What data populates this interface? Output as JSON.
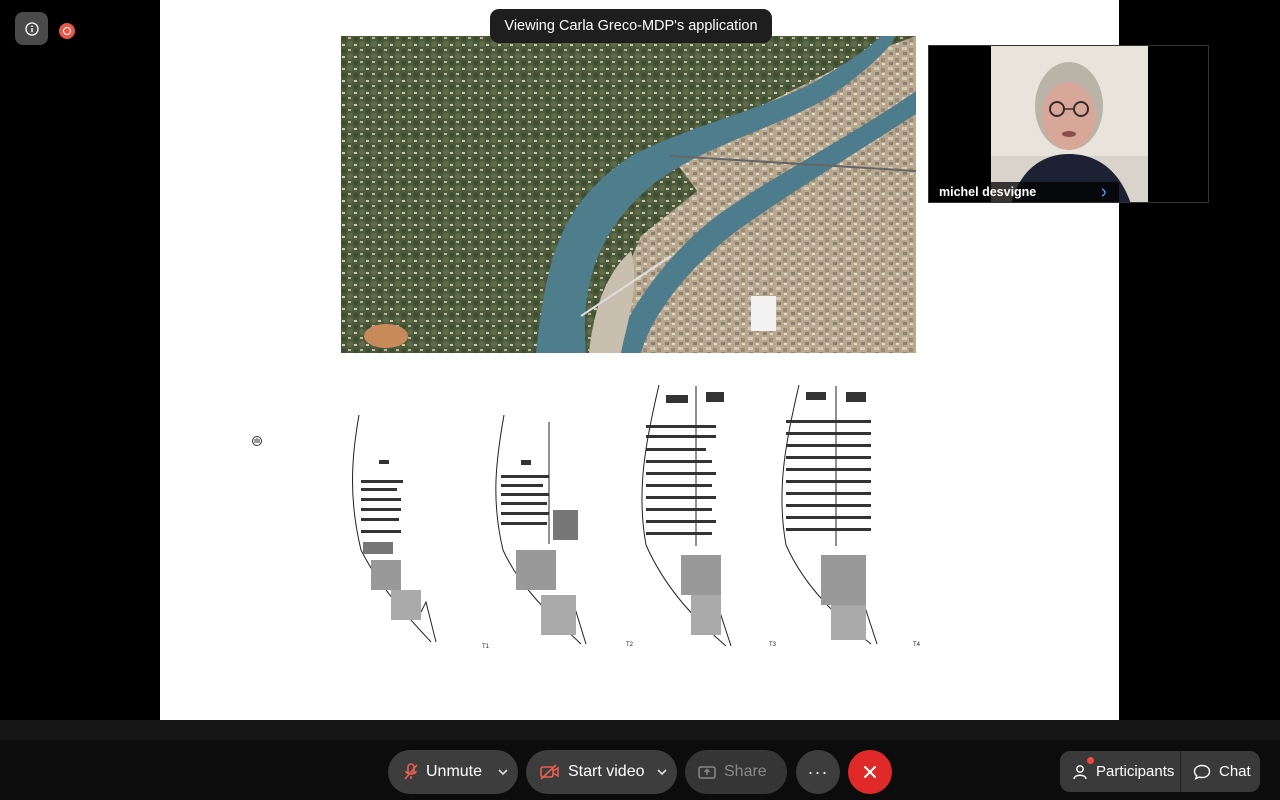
{
  "banner": {
    "viewing_text": "Viewing Carla Greco-MDP's application"
  },
  "video": {
    "participant_name": "michel desvigne"
  },
  "plans": {
    "labels": [
      "T1",
      "T2",
      "T3",
      "T4"
    ]
  },
  "toolbar": {
    "unmute_label": "Unmute",
    "start_video_label": "Start video",
    "share_label": "Share",
    "more_label": "···",
    "participants_label": "Participants",
    "chat_label": "Chat"
  },
  "colors": {
    "leave_button": "#e02a2a",
    "recording": "#e5584a",
    "mic_muted_icon": "#e8604f",
    "video_off_icon": "#e8604f",
    "notification_dot": "#ee4b3e"
  },
  "icons": {
    "info": "info-icon",
    "recording": "recording-icon",
    "mic": "mic-muted-icon",
    "camera": "video-off-icon",
    "share": "share-icon",
    "more": "more-icon",
    "leave": "close-icon",
    "participants": "participants-icon",
    "chat": "chat-icon"
  }
}
